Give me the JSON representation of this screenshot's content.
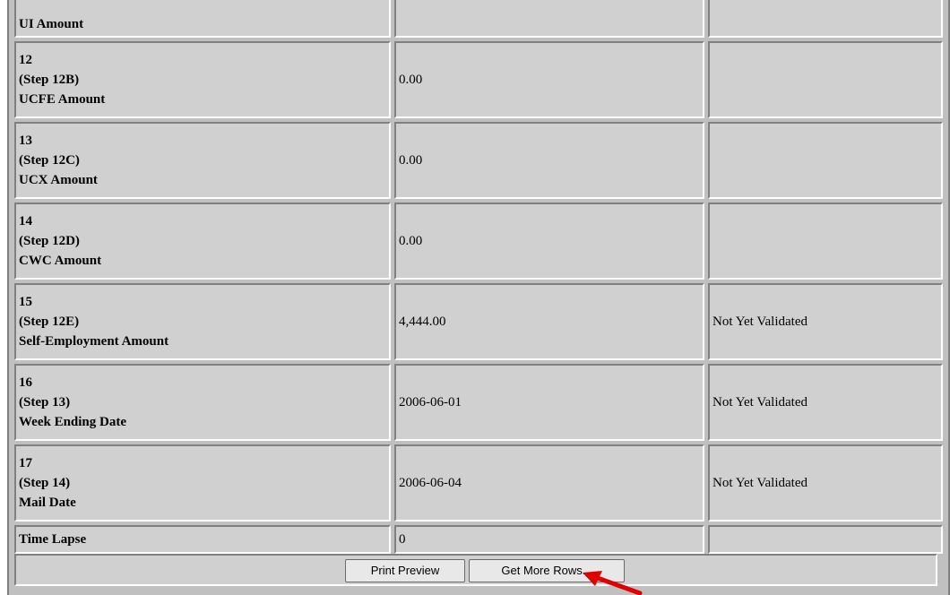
{
  "rows": [
    {
      "number": "",
      "step": "",
      "name": "UI Amount",
      "value": "",
      "status": ""
    },
    {
      "number": "12",
      "step": "(Step 12B)",
      "name": "UCFE Amount",
      "value": "0.00",
      "status": ""
    },
    {
      "number": "13",
      "step": "(Step 12C)",
      "name": "UCX Amount",
      "value": "0.00",
      "status": ""
    },
    {
      "number": "14",
      "step": "(Step 12D)",
      "name": "CWC Amount",
      "value": "0.00",
      "status": ""
    },
    {
      "number": "15",
      "step": "(Step 12E)",
      "name": "Self-Employment Amount",
      "value": "4,444.00",
      "status": "Not Yet Validated"
    },
    {
      "number": "16",
      "step": "(Step 13)",
      "name": "Week Ending Date",
      "value": "2006-06-01",
      "status": "Not Yet Validated"
    },
    {
      "number": "17",
      "step": "(Step 14)",
      "name": "Mail Date",
      "value": "2006-06-04",
      "status": "Not Yet Validated"
    }
  ],
  "time_lapse": {
    "label": "Time Lapse",
    "value": "0",
    "status": ""
  },
  "buttons": {
    "print_preview": "Print Preview",
    "get_more_rows": "Get More Rows..."
  },
  "annotation": {
    "arrow_color": "#e00000"
  }
}
